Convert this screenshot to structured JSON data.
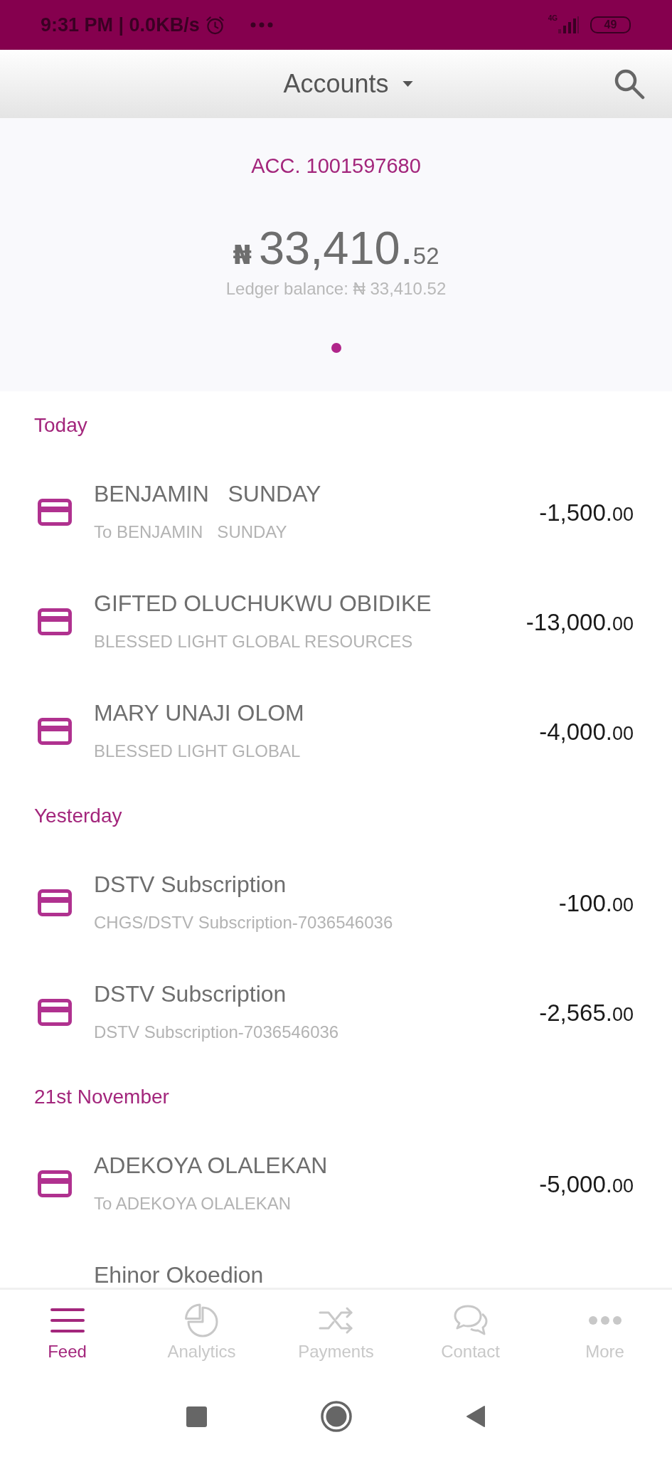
{
  "status_bar": {
    "time": "9:31 PM | 0.0KB/s",
    "network": "4G",
    "battery": "49"
  },
  "header": {
    "title": "Accounts"
  },
  "account": {
    "number": "ACC. 1001597680",
    "currency": "₦",
    "balance": "33,410.52",
    "ledger": "Ledger balance: ₦ 33,410.52",
    "pages": [
      {
        "selected": true
      }
    ]
  },
  "feed": [
    {
      "heading": "Today",
      "transactions": [
        {
          "title": "BENJAMIN   SUNDAY",
          "subtitle": "To BENJAMIN   SUNDAY",
          "amount": "-1,500.00"
        },
        {
          "title": "GIFTED OLUCHUKWU OBIDIKE",
          "subtitle": "BLESSED LIGHT GLOBAL RESOURCES",
          "amount": "-13,000.00"
        },
        {
          "title": "MARY UNAJI OLOM",
          "subtitle": "BLESSED LIGHT GLOBAL",
          "amount": "-4,000.00"
        }
      ]
    },
    {
      "heading": "Yesterday",
      "transactions": [
        {
          "title": "DSTV Subscription",
          "subtitle": "CHGS/DSTV Subscription-7036546036",
          "amount": "-100.00"
        },
        {
          "title": "DSTV Subscription",
          "subtitle": "DSTV Subscription-7036546036",
          "amount": "-2,565.00"
        }
      ]
    },
    {
      "heading": "21st November",
      "transactions": [
        {
          "title": "ADEKOYA OLALEKAN",
          "subtitle": "To ADEKOYA OLALEKAN",
          "amount": "-5,000.00"
        },
        {
          "title": "Ehinor Okoedion"
        }
      ]
    }
  ],
  "nav": [
    {
      "label": "Feed",
      "selected": true
    },
    {
      "label": "Analytics",
      "selected": false
    },
    {
      "label": "Payments",
      "selected": false
    },
    {
      "label": "Contact",
      "selected": false
    },
    {
      "label": "More",
      "selected": false
    }
  ]
}
